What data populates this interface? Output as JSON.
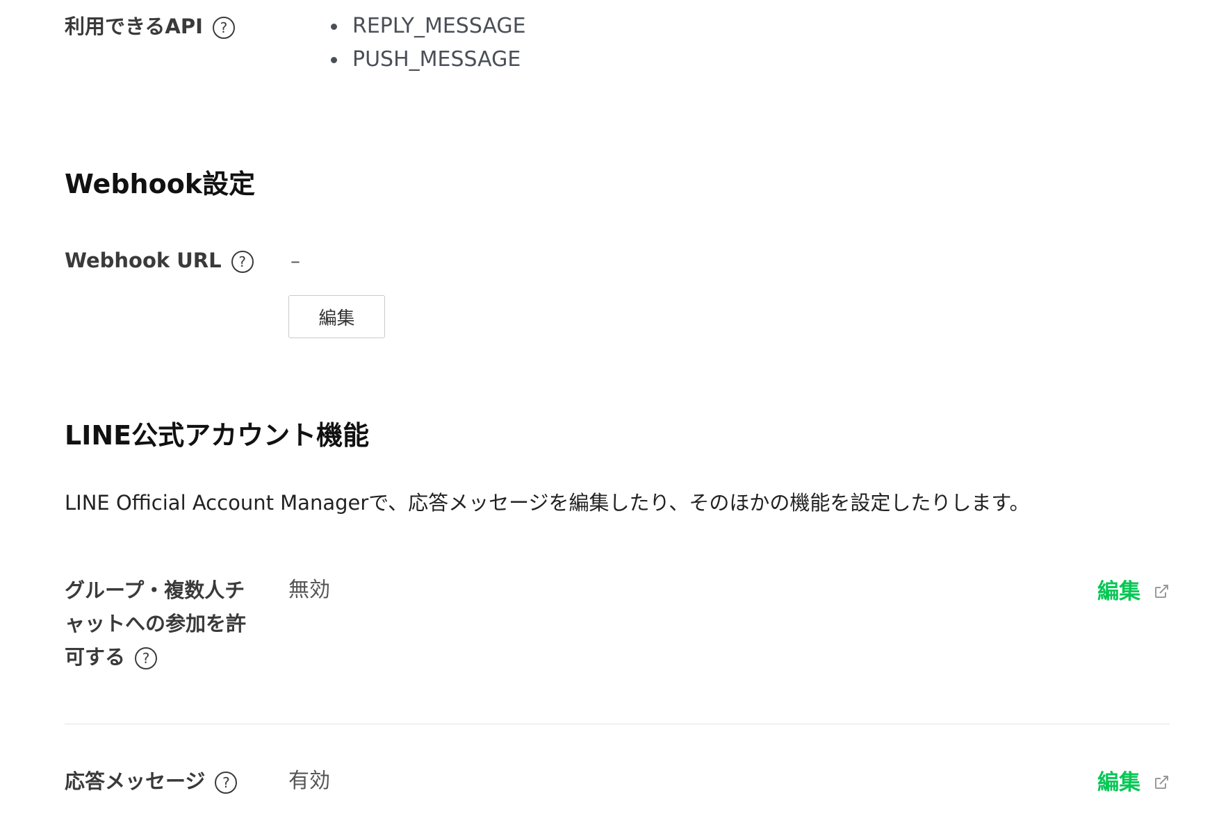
{
  "api_section": {
    "label": "利用できるAPI",
    "items": [
      "REPLY_MESSAGE",
      "PUSH_MESSAGE"
    ]
  },
  "webhook_section": {
    "title": "Webhook設定",
    "url_label": "Webhook URL",
    "url_value": "–",
    "edit_button_label": "編集"
  },
  "line_oa_section": {
    "title": "LINE公式アカウント機能",
    "description": "LINE Official Account Managerで、応答メッセージを編集したり、そのほかの機能を設定したりします。",
    "settings": [
      {
        "label_line1": "グループ・複数人チ",
        "label_line2": "ャットへの参加を許",
        "label_line3": "可する",
        "value": "無効",
        "edit_label": "編集"
      },
      {
        "label_line1": "応答メッセージ",
        "value": "有効",
        "edit_label": "編集"
      }
    ]
  },
  "colors": {
    "accent_green": "#06c755"
  },
  "icons": {
    "help": "question-circle-icon",
    "external": "external-link-icon"
  }
}
